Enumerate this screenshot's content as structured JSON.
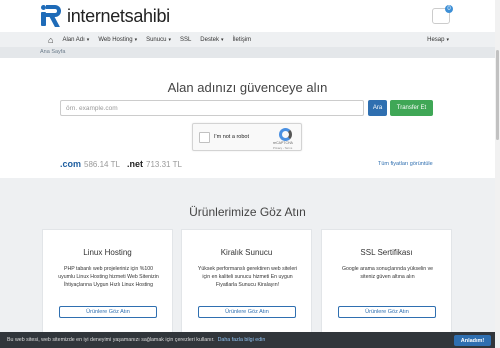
{
  "header": {
    "logo_text": "internetsahibi",
    "cart_badge": "0"
  },
  "nav": {
    "items": [
      {
        "label": "Alan Adı",
        "caret": "▾"
      },
      {
        "label": "Web Hosting",
        "caret": "▾"
      },
      {
        "label": "Sunucu",
        "caret": "▾"
      },
      {
        "label": "SSL",
        "caret": ""
      },
      {
        "label": "Destek",
        "caret": "▾"
      },
      {
        "label": "İletişim",
        "caret": ""
      }
    ],
    "account_label": "Hesap",
    "account_caret": "▾"
  },
  "breadcrumb": {
    "home": "Ana Sayfa"
  },
  "hero": {
    "title": "Alan adınızı güvenceye alın",
    "input_placeholder": "örn. example.com",
    "search_label": "Ara",
    "transfer_label": "Transfer Et",
    "captcha": {
      "label": "I'm not a robot",
      "brand": "reCAPTCHA",
      "terms": "Privacy - Terms"
    },
    "tlds": [
      {
        "name": ".com",
        "price": "586.14 TL"
      },
      {
        "name": ".net",
        "price": "713.31 TL"
      }
    ],
    "all_prices_link": "Tüm fiyatları görüntüle"
  },
  "products": {
    "title": "Ürünlerimize Göz Atın",
    "cards": [
      {
        "title": "Linux Hosting",
        "description": "PHP tabanlı web projeleriniz için %100 uyumlu Linux Hosting hizmeti Web Sitenizin İhtiyaçlarına Uygun Hızlı Linux Hosting",
        "button": "Ürünlere Göz Atın"
      },
      {
        "title": "Kiralık Sunucu",
        "description": "Yüksek performanslı gerektiren web siteleri için en kaliteli sunucu hizmeti En uygun Fiyatlarla Sunucu Kiralayın!",
        "button": "Ürünlere Göz Atın"
      },
      {
        "title": "SSL Sertifikası",
        "description": "Google arama sonuçlarında yükselin ve siteniz güven altına alın",
        "button": "Ürünlere Göz Atın"
      }
    ]
  },
  "cookie": {
    "text": "Bu web sitesi, web sitemizde en iyi deneyimi yaşamanızı sağlamak için çerezleri kullanır.",
    "link": "Daha fazla bilgi edin",
    "accept": "Anladım!"
  },
  "colors": {
    "brand_blue": "#2f6fb0",
    "transfer_green": "#3fa756",
    "cookie_bg": "#31363b"
  }
}
